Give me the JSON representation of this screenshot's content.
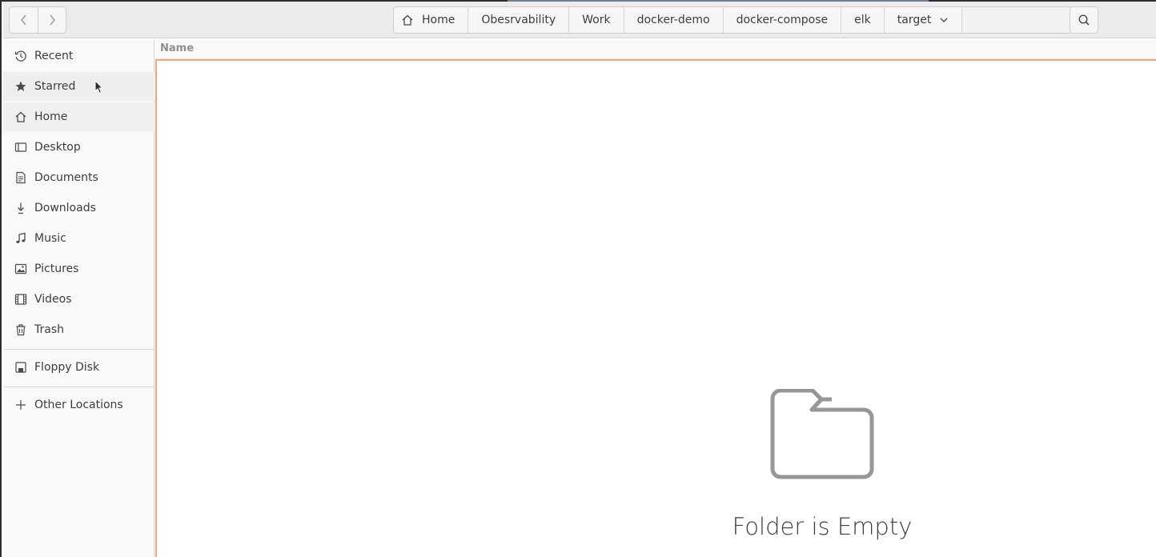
{
  "navigation": {
    "back_icon": "chevron-left-icon",
    "forward_icon": "chevron-right-icon"
  },
  "pathbar": {
    "crumbs": [
      {
        "label": "Home",
        "icon": "home-icon"
      },
      {
        "label": "Obesrvability"
      },
      {
        "label": "Work"
      },
      {
        "label": "docker-demo"
      },
      {
        "label": "docker-compose"
      },
      {
        "label": "elk"
      },
      {
        "label": "target",
        "icon": "chevron-down-icon"
      }
    ]
  },
  "search": {
    "icon": "search-icon"
  },
  "sidebar": {
    "places": [
      {
        "label": "Recent",
        "icon": "clock-icon"
      },
      {
        "label": "Starred",
        "icon": "star-icon"
      },
      {
        "label": "Home",
        "icon": "home-icon"
      },
      {
        "label": "Desktop",
        "icon": "desktop-icon"
      },
      {
        "label": "Documents",
        "icon": "document-icon"
      },
      {
        "label": "Downloads",
        "icon": "download-icon"
      },
      {
        "label": "Music",
        "icon": "music-icon"
      },
      {
        "label": "Pictures",
        "icon": "picture-icon"
      },
      {
        "label": "Videos",
        "icon": "film-icon"
      },
      {
        "label": "Trash",
        "icon": "trash-icon"
      }
    ],
    "devices": [
      {
        "label": "Floppy Disk",
        "icon": "floppy-disk-icon"
      }
    ],
    "other": {
      "label": "Other Locations",
      "icon": "plus-icon"
    }
  },
  "list": {
    "column_name": "Name",
    "empty_message": "Folder is Empty",
    "empty_icon": "folder-icon"
  },
  "colors": {
    "accent_border": "#f0a585",
    "headerbar": "#ebebeb",
    "sidebar": "#f9f9f9"
  }
}
